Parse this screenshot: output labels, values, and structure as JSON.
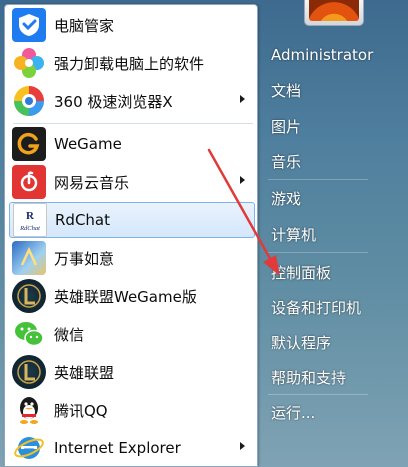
{
  "programs": [
    {
      "label": "电脑管家",
      "icon": "tencent-pc-manager-icon",
      "submenu": false
    },
    {
      "label": "强力卸载电脑上的软件",
      "icon": "uninstall-flower-icon",
      "submenu": false
    },
    {
      "label": "360 极速浏览器X",
      "icon": "360-browser-icon",
      "submenu": true
    },
    {
      "label": "WeGame",
      "icon": "wegame-icon",
      "submenu": false
    },
    {
      "label": "网易云音乐",
      "icon": "netease-music-icon",
      "submenu": true
    },
    {
      "label": "RdChat",
      "icon": "rdchat-icon",
      "submenu": false
    },
    {
      "label": "万事如意",
      "icon": "wanshi-ruyi-icon",
      "submenu": false
    },
    {
      "label": "英雄联盟WeGame版",
      "icon": "league-of-legends-icon",
      "submenu": false
    },
    {
      "label": "微信",
      "icon": "wechat-icon",
      "submenu": false
    },
    {
      "label": "英雄联盟",
      "icon": "league-of-legends-icon",
      "submenu": false
    },
    {
      "label": "腾讯QQ",
      "icon": "qq-penguin-icon",
      "submenu": false
    },
    {
      "label": "Internet Explorer",
      "icon": "internet-explorer-icon",
      "submenu": true
    }
  ],
  "rdchat_icon_text": "R\nRdChat",
  "right_links": {
    "user": "Administrator",
    "documents": "文档",
    "pictures": "图片",
    "music": "音乐",
    "games": "游戏",
    "computer": "计算机",
    "control_panel": "控制面板",
    "devices_printers": "设备和打印机",
    "default_programs": "默认程序",
    "help_support": "帮助和支持",
    "run": "运行..."
  },
  "colors": {
    "selection_border": "#7eb4ea",
    "annotation_arrow": "#e03a3a"
  }
}
